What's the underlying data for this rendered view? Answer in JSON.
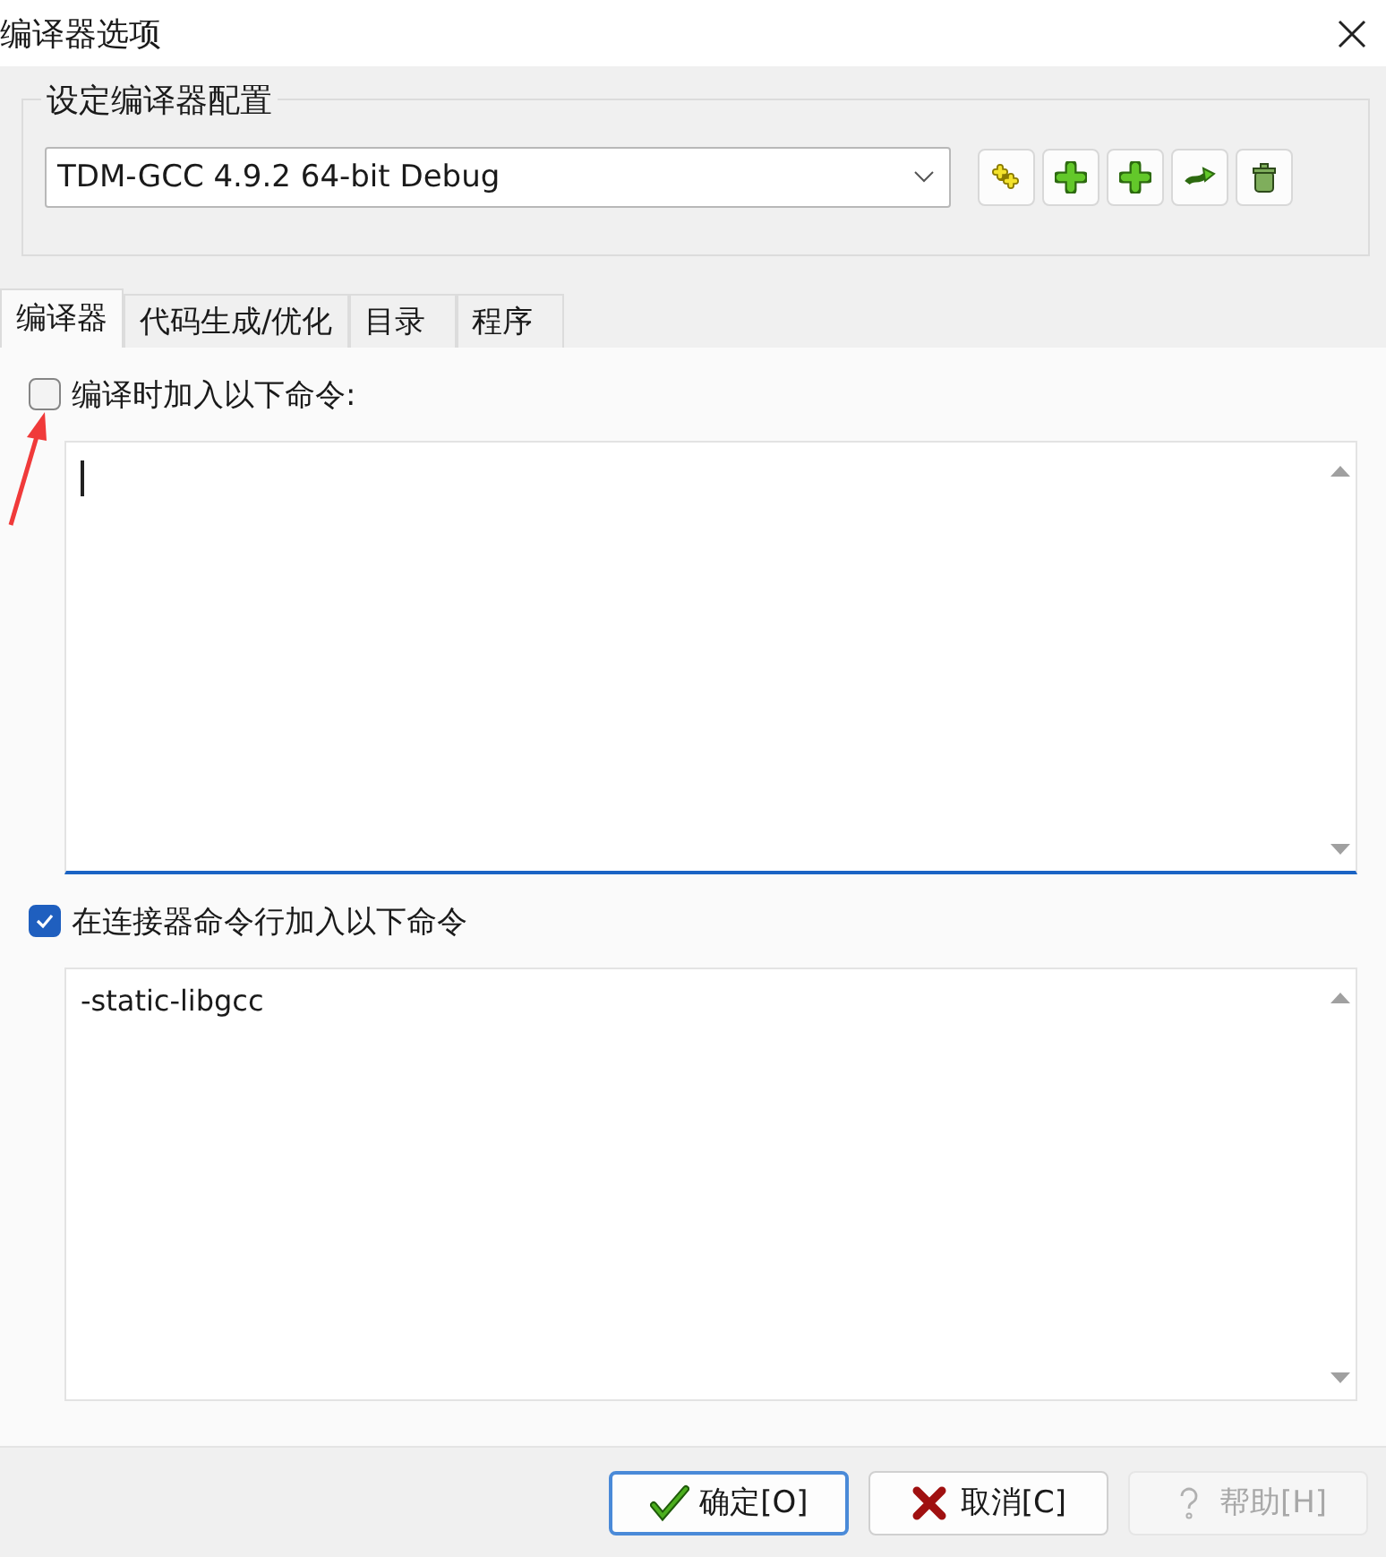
{
  "window": {
    "title": "编译器选项"
  },
  "config": {
    "label": "设定编译器配置",
    "value": "TDM-GCC 4.9.2 64-bit Debug",
    "tools": [
      {
        "kind": "rename"
      },
      {
        "kind": "add"
      },
      {
        "kind": "add"
      },
      {
        "kind": "export"
      },
      {
        "kind": "delete"
      }
    ]
  },
  "tabs": [
    {
      "label": "编译器",
      "selected": true
    },
    {
      "label": "代码生成/优化",
      "selected": false
    },
    {
      "label": "目录",
      "selected": false
    },
    {
      "label": "程序",
      "selected": false
    }
  ],
  "options": [
    {
      "label": "编译时加入以下命令:",
      "checked": false,
      "focused": true,
      "annotated": true
    },
    {
      "label": "在连接器命令行加入以下命令",
      "checked": true,
      "value": "-static-libgcc",
      "focused": false,
      "annotated": false
    }
  ],
  "buttons": [
    {
      "kind": "ok",
      "label": "确定[O]",
      "disabled": false,
      "default": true
    },
    {
      "kind": "cancel",
      "label": "取消[C]",
      "disabled": false,
      "default": false
    },
    {
      "kind": "help",
      "label": "帮助[H]",
      "disabled": true,
      "default": false
    }
  ]
}
